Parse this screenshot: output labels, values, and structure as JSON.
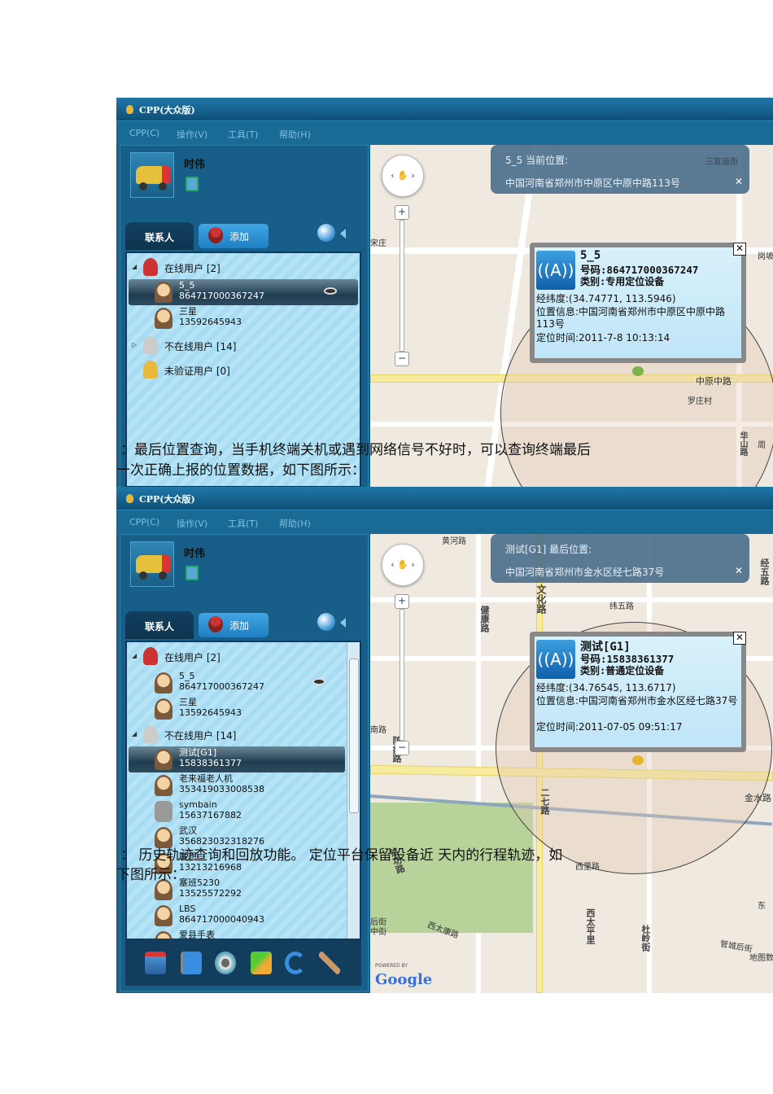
{
  "doc": {
    "line1": "：最后位置查询，当手机终端关机或遇到网络信号不好时，可以查询终端最后",
    "line2": "一次正确上报的位置数据，如下图所示：",
    "line3": "：  历史轨迹查询和回放功能。    定位平台保留设备近    天内的行程轨迹，如",
    "line4": "下图所示："
  },
  "app": {
    "title": "CPP(大众版)",
    "menu": [
      "CPP(C)",
      "操作(V)",
      "工具(T)",
      "帮助(H)"
    ],
    "user": "时伟",
    "tab_contacts": "联系人",
    "tab_add": "添加"
  },
  "win1": {
    "groups": {
      "online": "在线用户  [2]",
      "offline": "不在线用户  [14]",
      "unverified": "未验证用户  [0]"
    },
    "items": [
      {
        "name": "5_5",
        "id": "864717000367247"
      },
      {
        "name": "三星",
        "id": "13592645943"
      }
    ],
    "banner": {
      "title": "5_5 当前位置:",
      "address": "中国河南省郑州市中原区中原中路113号",
      "close": "✕"
    },
    "popup": {
      "name": "5_5",
      "number": "号码:864717000367247",
      "type": "类别:专用定位设备",
      "coords": "经纬度:(34.74771, 113.5946)",
      "location": "位置信息:中国河南省郑州市中原区中原中路113号",
      "time": "定位时间:2011-7-8 10:13:14"
    },
    "labels": {
      "a": "宋庄",
      "b": "三官庙街",
      "c": "岗坡",
      "d": "中原中路",
      "e": "罗庄村",
      "f": "华山路",
      "g": "周"
    }
  },
  "win2": {
    "groups": {
      "online": "在线用户  [2]",
      "offline": "不在线用户  [14]"
    },
    "online": [
      {
        "name": "5_5",
        "id": "864717000367247"
      },
      {
        "name": "三星",
        "id": "13592645943"
      }
    ],
    "offline": [
      {
        "name": "测试[G1]",
        "id": "15838361377"
      },
      {
        "name": "老来福老人机",
        "id": "353419033008538"
      },
      {
        "name": "symbain",
        "id": "15637167882"
      },
      {
        "name": "武汉",
        "id": "356823032318276"
      },
      {
        "name": "联想",
        "id": "13213216968"
      },
      {
        "name": "塞班5230",
        "id": "13525572292"
      },
      {
        "name": "LBS",
        "id": "864717000040943"
      },
      {
        "name": "爱县手表",
        "id": ""
      }
    ],
    "banner": {
      "title": "测试[G1] 最后位置:",
      "address": "中国河南省郑州市金水区经七路37号",
      "close": "✕"
    },
    "popup": {
      "name": "测试[G1]",
      "number": "号码:15838361377",
      "type": "类别:普通定位设备",
      "coords": "经纬度:(34.76545, 113.6717)",
      "location": "位置信息:中国河南省郑州市金水区经七路37号",
      "time": "定位时间:2011-07-05 09:51:17"
    },
    "labels": {
      "huanghe": "黄河路",
      "wenhua": "文化路",
      "jiankang": "健康路",
      "weiwu": "纬五路",
      "jingwu": "经五路",
      "nan": "南路",
      "fangyi": "防疫路",
      "jinshui": "金水路",
      "erqi": "二七路",
      "xili": "西里路",
      "minggong": "铭功路",
      "xitaikang": "西太康路",
      "xitaiping": "西太平里",
      "duling": "杜岭街",
      "guancheng": "管城后街",
      "dong": "东",
      "houjie": "后街",
      "zhongjie": "中街",
      "ditu": "地图数"
    },
    "powered": "POWERED BY",
    "google": "Google"
  }
}
